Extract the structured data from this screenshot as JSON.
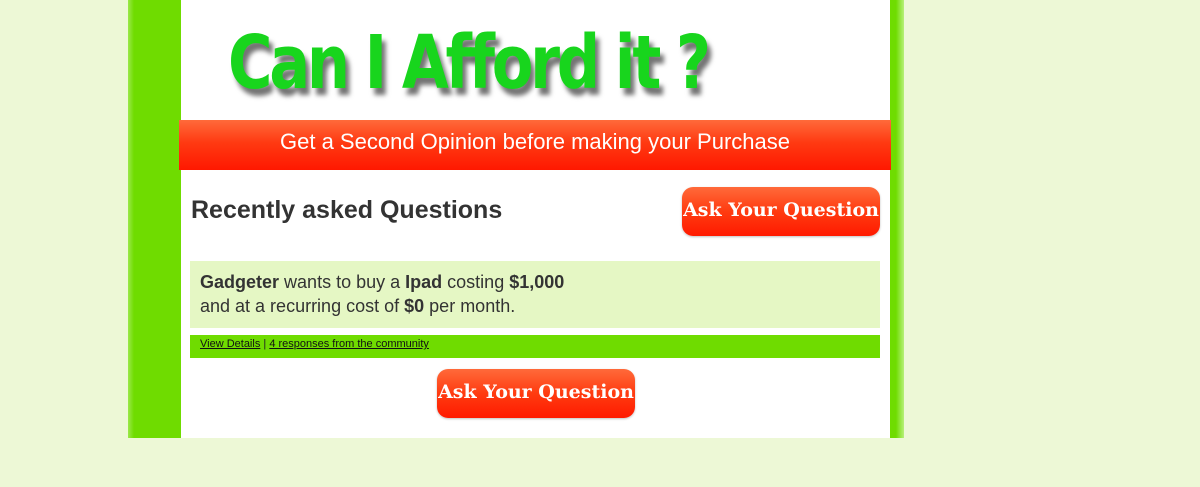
{
  "header": {
    "logo_text": "Can I Afford it ?",
    "tagline": "Get a Second Opinion before making your Purchase"
  },
  "main": {
    "section_title": "Recently asked Questions",
    "ask_button_label": "Ask Your Question",
    "questions": [
      {
        "user": "Gadgeter",
        "text_wants": "wants to buy a",
        "item": "Ipad",
        "text_costing": "costing",
        "cost": "$1,000",
        "text_recurring": "and at a recurring cost of",
        "recurring_cost": "$0",
        "text_per_month": "per month.",
        "view_details_label": "View Details",
        "separator": "|",
        "responses_label": "4 responses from the community"
      }
    ]
  },
  "colors": {
    "page_background": "#edf8d6",
    "brand_green": "#6fdc00",
    "logo_green": "#18d51d",
    "accent_red": "#ff3a12",
    "card_background": "#e5f7c4"
  }
}
